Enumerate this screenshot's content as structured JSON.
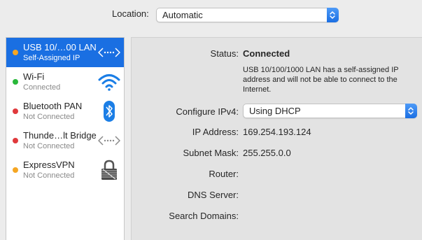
{
  "location": {
    "label": "Location:",
    "value": "Automatic",
    "stepper_icon": "up-down-chevron-icon"
  },
  "sidebar": {
    "services": [
      {
        "name": "USB 10/…00 LAN",
        "status": "Self-Assigned IP",
        "dot_color": "#f5a623",
        "icon": "ethernet-arrows-icon",
        "selected": true
      },
      {
        "name": "Wi-Fi",
        "status": "Connected",
        "dot_color": "#29b83a",
        "icon": "wifi-icon",
        "selected": false
      },
      {
        "name": "Bluetooth PAN",
        "status": "Not Connected",
        "dot_color": "#e0393c",
        "icon": "bluetooth-icon",
        "selected": false
      },
      {
        "name": "Thunde…lt Bridge",
        "status": "Not Connected",
        "dot_color": "#e0393c",
        "icon": "ethernet-arrows-icon",
        "selected": false
      },
      {
        "name": "ExpressVPN",
        "status": "Not Connected",
        "dot_color": "#f5a623",
        "icon": "vpn-lock-icon",
        "selected": false
      }
    ]
  },
  "details": {
    "status_label": "Status:",
    "status_value": "Connected",
    "status_description": "USB 10/100/1000 LAN has a self-assigned IP address and will not be able to connect to the Internet.",
    "configure_label": "Configure IPv4:",
    "configure_value": "Using DHCP",
    "ip_label": "IP Address:",
    "ip_value": "169.254.193.124",
    "subnet_label": "Subnet Mask:",
    "subnet_value": "255.255.0.0",
    "router_label": "Router:",
    "router_value": "",
    "dns_label": "DNS Server:",
    "dns_value": "",
    "search_label": "Search Domains:",
    "search_value": ""
  },
  "colors": {
    "selection": "#1a6fe2",
    "connected": "#29b83a",
    "disconnected": "#e0393c",
    "warning": "#f5a623"
  }
}
